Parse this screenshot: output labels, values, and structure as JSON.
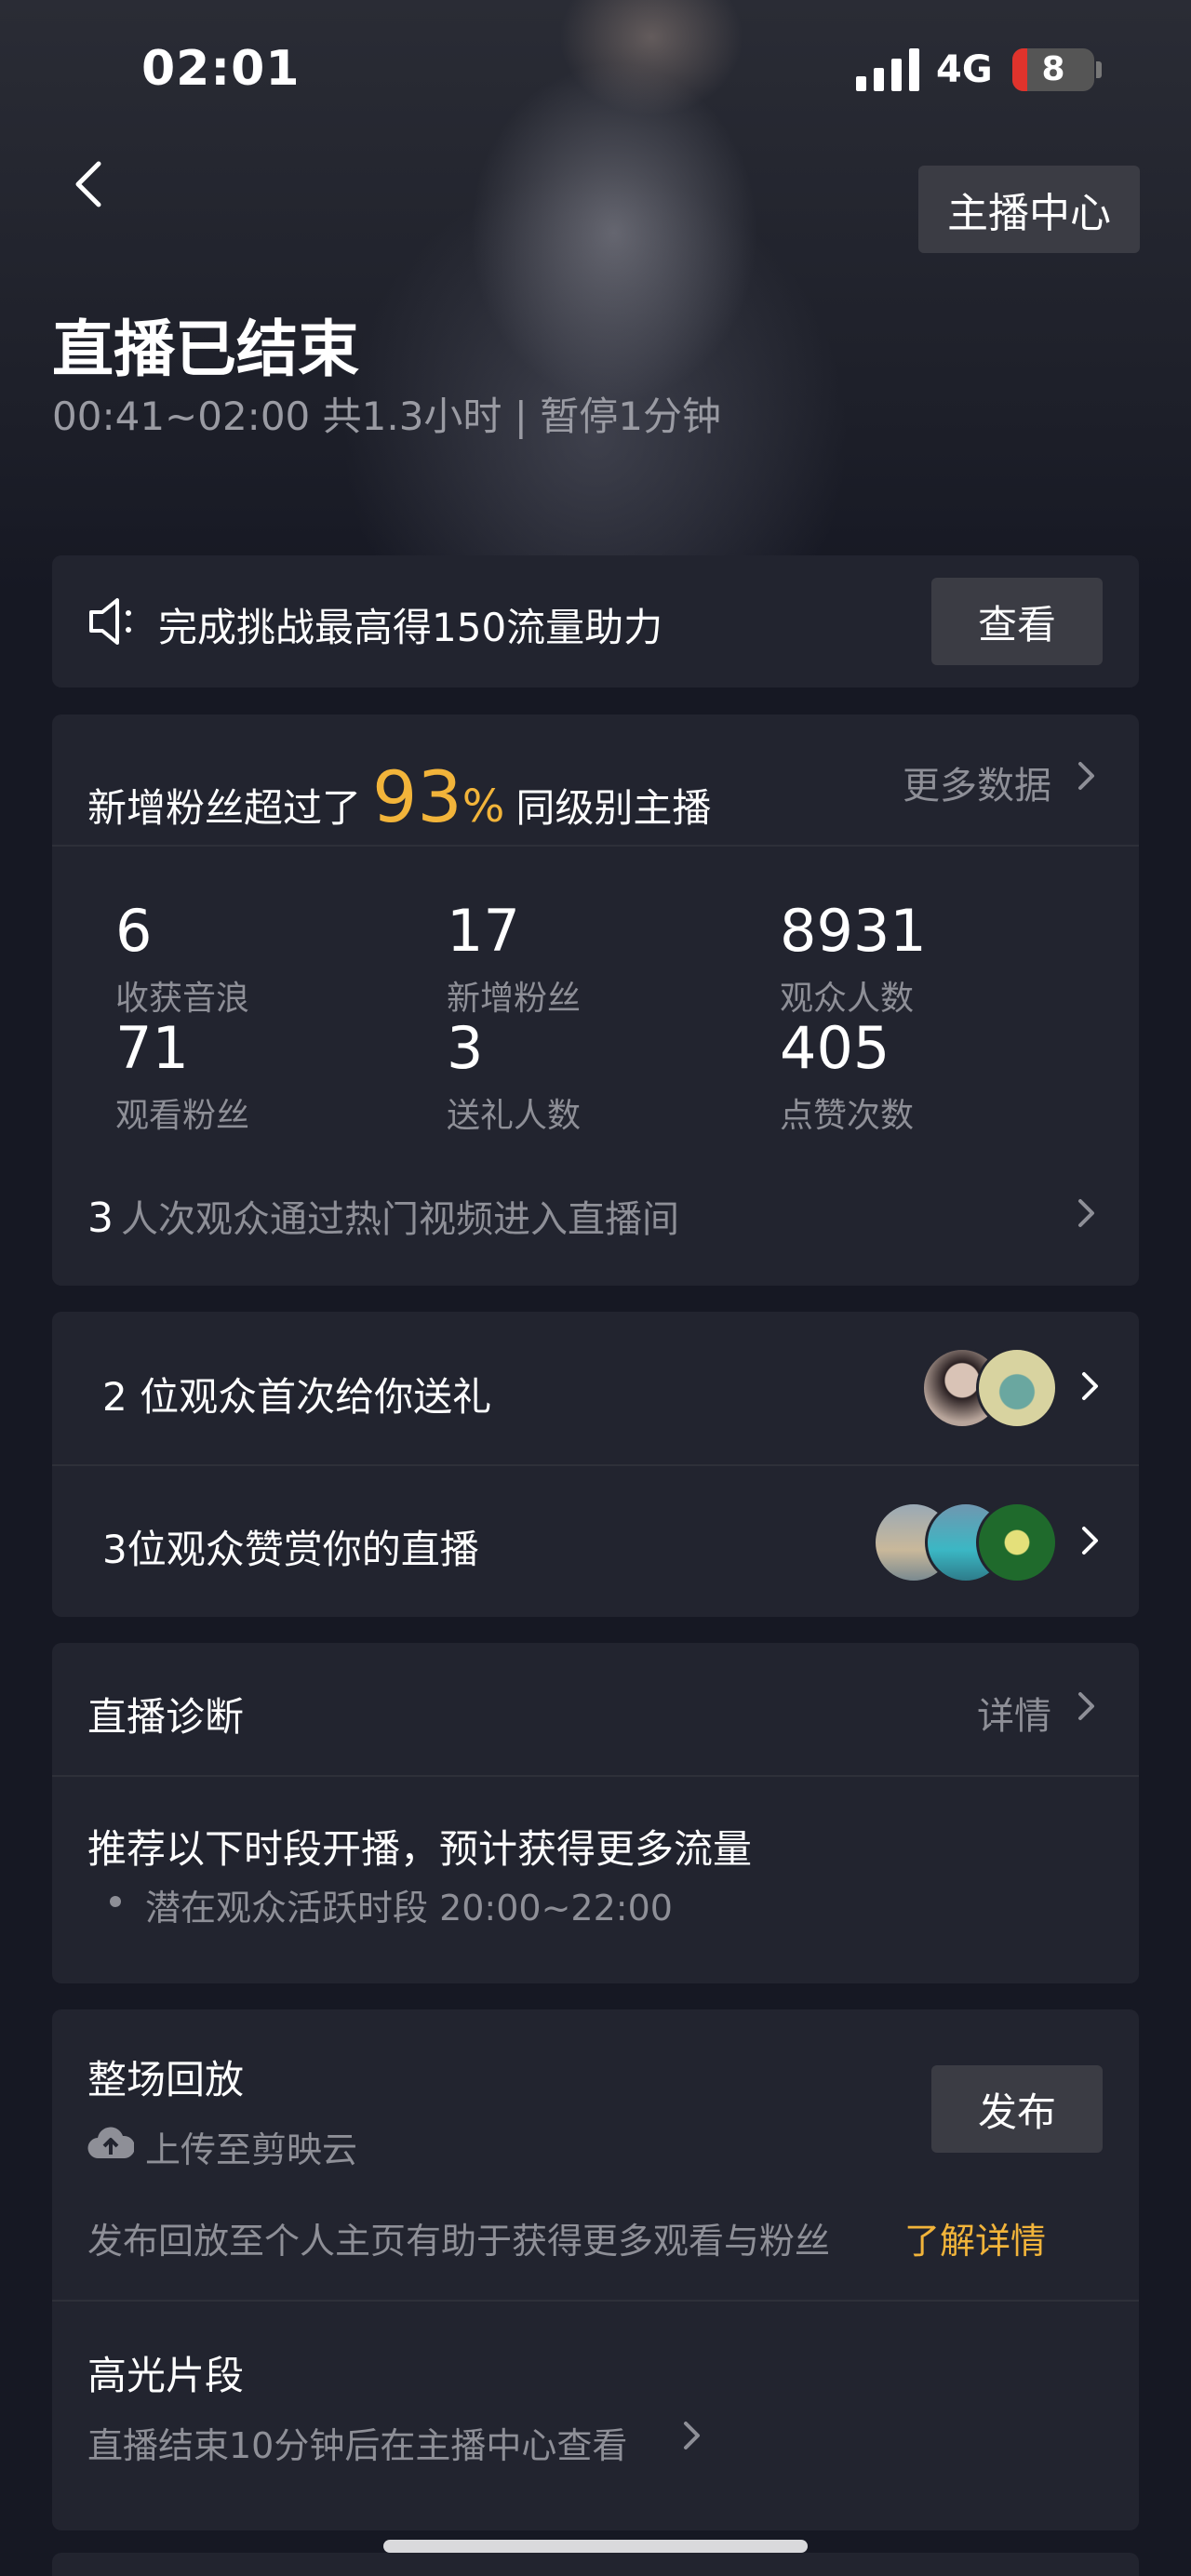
{
  "status_bar": {
    "time": "02:01",
    "network": "4G",
    "battery": "8"
  },
  "header": {
    "host_center_label": "主播中心",
    "title": "直播已结束",
    "subtitle": "00:41~02:00 共1.3小时 | 暂停1分钟"
  },
  "challenge": {
    "text": "完成挑战最高得150流量助力",
    "view_label": "查看"
  },
  "stats": {
    "headline_prefix": "新增粉丝超过了",
    "headline_percent": "93",
    "headline_percent_sign": "%",
    "headline_suffix": "同级别主播",
    "more_data_label": "更多数据",
    "items": [
      {
        "value": "6",
        "label": "收获音浪"
      },
      {
        "value": "17",
        "label": "新增粉丝"
      },
      {
        "value": "8931",
        "label": "观众人数"
      },
      {
        "value": "71",
        "label": "观看粉丝"
      },
      {
        "value": "3",
        "label": "送礼人数"
      },
      {
        "value": "405",
        "label": "点赞次数"
      }
    ],
    "hot_video_count": "3",
    "hot_video_text": "人次观众通过热门视频进入直播间"
  },
  "audience": {
    "first_gift_text": "2 位观众首次给你送礼",
    "appreciate_text": "3位观众赞赏你的直播"
  },
  "diagnosis": {
    "title": "直播诊断",
    "details_label": "详情",
    "recommendation": "推荐以下时段开播，预计获得更多流量",
    "bullet": "潜在观众活跃时段 20:00~22:00"
  },
  "replay": {
    "title": "整场回放",
    "upload_text": "上传至剪映云",
    "publish_label": "发布",
    "description": "发布回放至个人主页有助于获得更多观看与粉丝",
    "learn_more": "了解详情"
  },
  "highlights": {
    "title": "高光片段",
    "description": "直播结束10分钟后在主播中心查看"
  },
  "colors": {
    "accent_gold": "#f2b43a",
    "background": "#161823",
    "card": "#22242f"
  }
}
